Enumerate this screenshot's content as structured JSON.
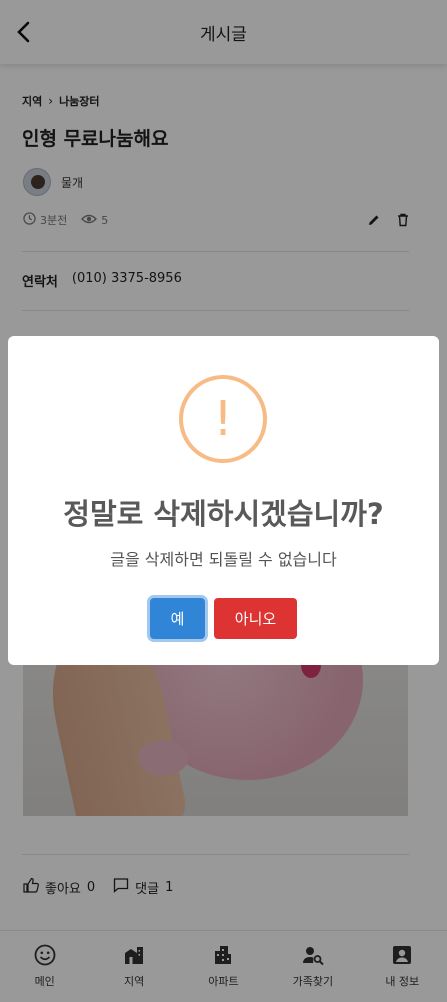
{
  "header": {
    "title": "게시글"
  },
  "post": {
    "breadcrumb": [
      "지역",
      "나눔장터"
    ],
    "title": "인형 무료나눔해요",
    "author": "물개",
    "time": "3분전",
    "views": "5",
    "contact_label": "연락처",
    "contact_value": "(010) 3375-8956"
  },
  "reactions": {
    "like_label": "좋아요",
    "like_count": "0",
    "comment_label": "댓글",
    "comment_count": "1"
  },
  "nav": {
    "items": [
      {
        "label": "메인",
        "icon": "smile-icon"
      },
      {
        "label": "지역",
        "icon": "city-icon"
      },
      {
        "label": "아파트",
        "icon": "apartment-icon"
      },
      {
        "label": "가족찾기",
        "icon": "person-search-icon"
      },
      {
        "label": "내 정보",
        "icon": "account-box-icon"
      }
    ]
  },
  "dialog": {
    "icon": "!",
    "title": "정말로 삭제하시겠습니까?",
    "message": "글을 삭제하면 되돌릴 수 없습니다",
    "confirm_label": "예",
    "cancel_label": "아니오"
  },
  "colors": {
    "confirm": "#3085d6",
    "cancel": "#dd3333",
    "warning": "#f8bb86"
  }
}
